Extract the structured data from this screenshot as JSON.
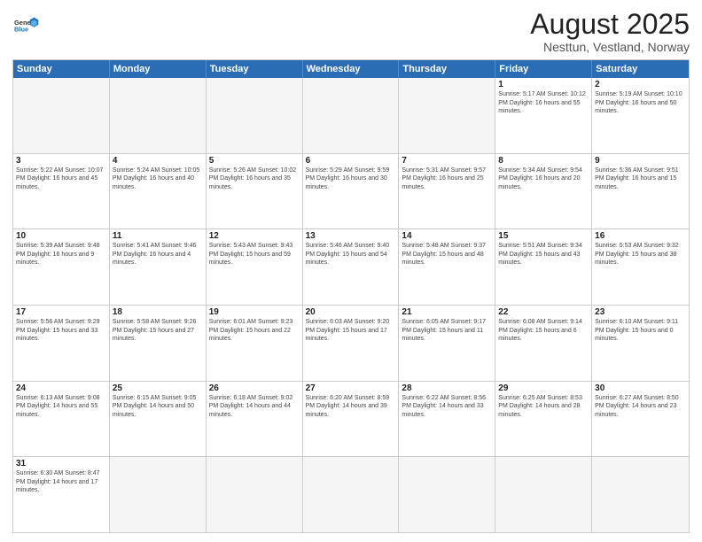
{
  "logo": {
    "text_general": "General",
    "text_blue": "Blue"
  },
  "header": {
    "title": "August 2025",
    "subtitle": "Nesttun, Vestland, Norway"
  },
  "weekdays": [
    "Sunday",
    "Monday",
    "Tuesday",
    "Wednesday",
    "Thursday",
    "Friday",
    "Saturday"
  ],
  "rows": [
    [
      {
        "day": "",
        "info": "",
        "empty": true
      },
      {
        "day": "",
        "info": "",
        "empty": true
      },
      {
        "day": "",
        "info": "",
        "empty": true
      },
      {
        "day": "",
        "info": "",
        "empty": true
      },
      {
        "day": "",
        "info": "",
        "empty": true
      },
      {
        "day": "1",
        "info": "Sunrise: 5:17 AM\nSunset: 10:12 PM\nDaylight: 16 hours\nand 55 minutes."
      },
      {
        "day": "2",
        "info": "Sunrise: 5:19 AM\nSunset: 10:10 PM\nDaylight: 16 hours\nand 50 minutes."
      }
    ],
    [
      {
        "day": "3",
        "info": "Sunrise: 5:22 AM\nSunset: 10:07 PM\nDaylight: 16 hours\nand 45 minutes."
      },
      {
        "day": "4",
        "info": "Sunrise: 5:24 AM\nSunset: 10:05 PM\nDaylight: 16 hours\nand 40 minutes."
      },
      {
        "day": "5",
        "info": "Sunrise: 5:26 AM\nSunset: 10:02 PM\nDaylight: 16 hours\nand 35 minutes."
      },
      {
        "day": "6",
        "info": "Sunrise: 5:29 AM\nSunset: 9:59 PM\nDaylight: 16 hours\nand 30 minutes."
      },
      {
        "day": "7",
        "info": "Sunrise: 5:31 AM\nSunset: 9:57 PM\nDaylight: 16 hours\nand 25 minutes."
      },
      {
        "day": "8",
        "info": "Sunrise: 5:34 AM\nSunset: 9:54 PM\nDaylight: 16 hours\nand 20 minutes."
      },
      {
        "day": "9",
        "info": "Sunrise: 5:36 AM\nSunset: 9:51 PM\nDaylight: 16 hours\nand 15 minutes."
      }
    ],
    [
      {
        "day": "10",
        "info": "Sunrise: 5:39 AM\nSunset: 9:48 PM\nDaylight: 16 hours\nand 9 minutes."
      },
      {
        "day": "11",
        "info": "Sunrise: 5:41 AM\nSunset: 9:46 PM\nDaylight: 16 hours\nand 4 minutes."
      },
      {
        "day": "12",
        "info": "Sunrise: 5:43 AM\nSunset: 9:43 PM\nDaylight: 15 hours\nand 59 minutes."
      },
      {
        "day": "13",
        "info": "Sunrise: 5:46 AM\nSunset: 9:40 PM\nDaylight: 15 hours\nand 54 minutes."
      },
      {
        "day": "14",
        "info": "Sunrise: 5:48 AM\nSunset: 9:37 PM\nDaylight: 15 hours\nand 48 minutes."
      },
      {
        "day": "15",
        "info": "Sunrise: 5:51 AM\nSunset: 9:34 PM\nDaylight: 15 hours\nand 43 minutes."
      },
      {
        "day": "16",
        "info": "Sunrise: 5:53 AM\nSunset: 9:32 PM\nDaylight: 15 hours\nand 38 minutes."
      }
    ],
    [
      {
        "day": "17",
        "info": "Sunrise: 5:56 AM\nSunset: 9:29 PM\nDaylight: 15 hours\nand 33 minutes."
      },
      {
        "day": "18",
        "info": "Sunrise: 5:58 AM\nSunset: 9:26 PM\nDaylight: 15 hours\nand 27 minutes."
      },
      {
        "day": "19",
        "info": "Sunrise: 6:01 AM\nSunset: 9:23 PM\nDaylight: 15 hours\nand 22 minutes."
      },
      {
        "day": "20",
        "info": "Sunrise: 6:03 AM\nSunset: 9:20 PM\nDaylight: 15 hours\nand 17 minutes."
      },
      {
        "day": "21",
        "info": "Sunrise: 6:05 AM\nSunset: 9:17 PM\nDaylight: 15 hours\nand 11 minutes."
      },
      {
        "day": "22",
        "info": "Sunrise: 6:08 AM\nSunset: 9:14 PM\nDaylight: 15 hours\nand 6 minutes."
      },
      {
        "day": "23",
        "info": "Sunrise: 6:10 AM\nSunset: 9:11 PM\nDaylight: 15 hours\nand 0 minutes."
      }
    ],
    [
      {
        "day": "24",
        "info": "Sunrise: 6:13 AM\nSunset: 9:08 PM\nDaylight: 14 hours\nand 55 minutes."
      },
      {
        "day": "25",
        "info": "Sunrise: 6:15 AM\nSunset: 9:05 PM\nDaylight: 14 hours\nand 50 minutes."
      },
      {
        "day": "26",
        "info": "Sunrise: 6:18 AM\nSunset: 9:02 PM\nDaylight: 14 hours\nand 44 minutes."
      },
      {
        "day": "27",
        "info": "Sunrise: 6:20 AM\nSunset: 8:59 PM\nDaylight: 14 hours\nand 39 minutes."
      },
      {
        "day": "28",
        "info": "Sunrise: 6:22 AM\nSunset: 8:56 PM\nDaylight: 14 hours\nand 33 minutes."
      },
      {
        "day": "29",
        "info": "Sunrise: 6:25 AM\nSunset: 8:53 PM\nDaylight: 14 hours\nand 28 minutes."
      },
      {
        "day": "30",
        "info": "Sunrise: 6:27 AM\nSunset: 8:50 PM\nDaylight: 14 hours\nand 23 minutes."
      }
    ],
    [
      {
        "day": "31",
        "info": "Sunrise: 6:30 AM\nSunset: 8:47 PM\nDaylight: 14 hours\nand 17 minutes."
      },
      {
        "day": "",
        "info": "",
        "empty": true
      },
      {
        "day": "",
        "info": "",
        "empty": true
      },
      {
        "day": "",
        "info": "",
        "empty": true
      },
      {
        "day": "",
        "info": "",
        "empty": true
      },
      {
        "day": "",
        "info": "",
        "empty": true
      },
      {
        "day": "",
        "info": "",
        "empty": true
      }
    ]
  ]
}
